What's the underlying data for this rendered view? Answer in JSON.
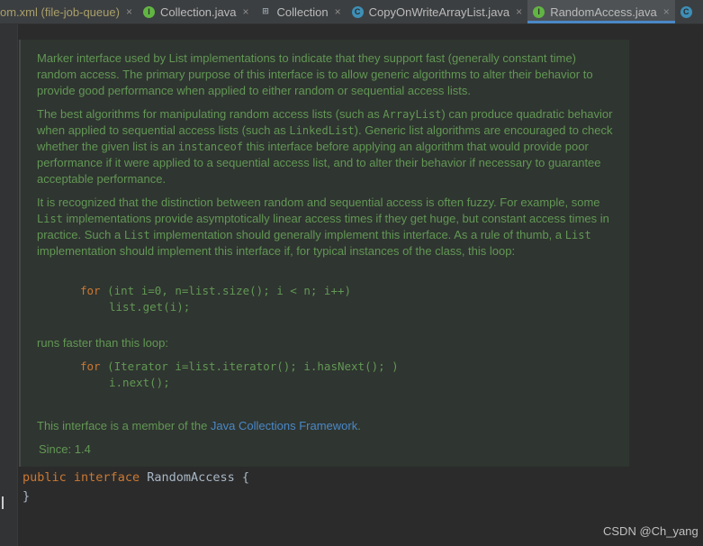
{
  "tabs": [
    {
      "icon": "xml-file-icon",
      "label": "om.xml (file-job-queue)",
      "close": "×",
      "active": false
    },
    {
      "icon": "interface-icon",
      "glyph": "I",
      "label": "Collection.java",
      "close": "×",
      "active": false
    },
    {
      "icon": "structure-icon",
      "glyph": "⊞",
      "label": "Collection",
      "close": "×",
      "active": false
    },
    {
      "icon": "class-icon",
      "glyph": "C",
      "label": "CopyOnWriteArrayList.java",
      "close": "×",
      "active": false
    },
    {
      "icon": "interface-icon",
      "glyph": "I",
      "label": "RandomAccess.java",
      "close": "×",
      "active": true
    }
  ],
  "overflow_tab_icon": "class-icon",
  "doc": {
    "p1": "Marker interface used by List implementations to indicate that they support fast (generally constant time) random access. The primary purpose of this interface is to allow generic algorithms to alter their behavior to provide good performance when applied to either random or sequential access lists.",
    "p2": {
      "t1": "The best algorithms for manipulating random access lists (such as ",
      "c1": "ArrayList",
      "t2": ") can produce quadratic behavior when applied to sequential access lists (such as ",
      "c2": "LinkedList",
      "t3": "). Generic list algorithms are encouraged to check whether the given list is an ",
      "c3": "instanceof",
      "t4": " this interface before applying an algorithm that would provide poor performance if it were applied to a sequential access list, and to alter their behavior if necessary to guarantee acceptable performance."
    },
    "p3": {
      "t1": "It is recognized that the distinction between random and sequential access is often fuzzy. For example, some ",
      "c1": "List",
      "t2": " implementations provide asymptotically linear access times if they get huge, but constant access times in practice. Such a ",
      "c2": "List",
      "t3": " implementation should generally implement this interface. As a rule of thumb, a ",
      "c3": "List",
      "t4": " implementation should implement this interface if, for typical instances of the class, this loop:"
    },
    "code1_kw": "for",
    "code1_l1": " (int i=0, n=list.size(); i < n; i++)",
    "code1_l2": "list.get(i);",
    "runs_faster": "runs faster than this loop:",
    "code2_kw": "for",
    "code2_l1": " (Iterator i=list.iterator(); i.hasNext(); )",
    "code2_l2": "i.next();",
    "member_text": "This interface is a member of the ",
    "member_link": "Java Collections Framework",
    "member_end": ".",
    "since": "Since: 1.4"
  },
  "source": {
    "kw1": "public",
    "kw2": "interface",
    "name": " RandomAccess {",
    "close": "}"
  },
  "watermark": "CSDN @Ch_yang"
}
